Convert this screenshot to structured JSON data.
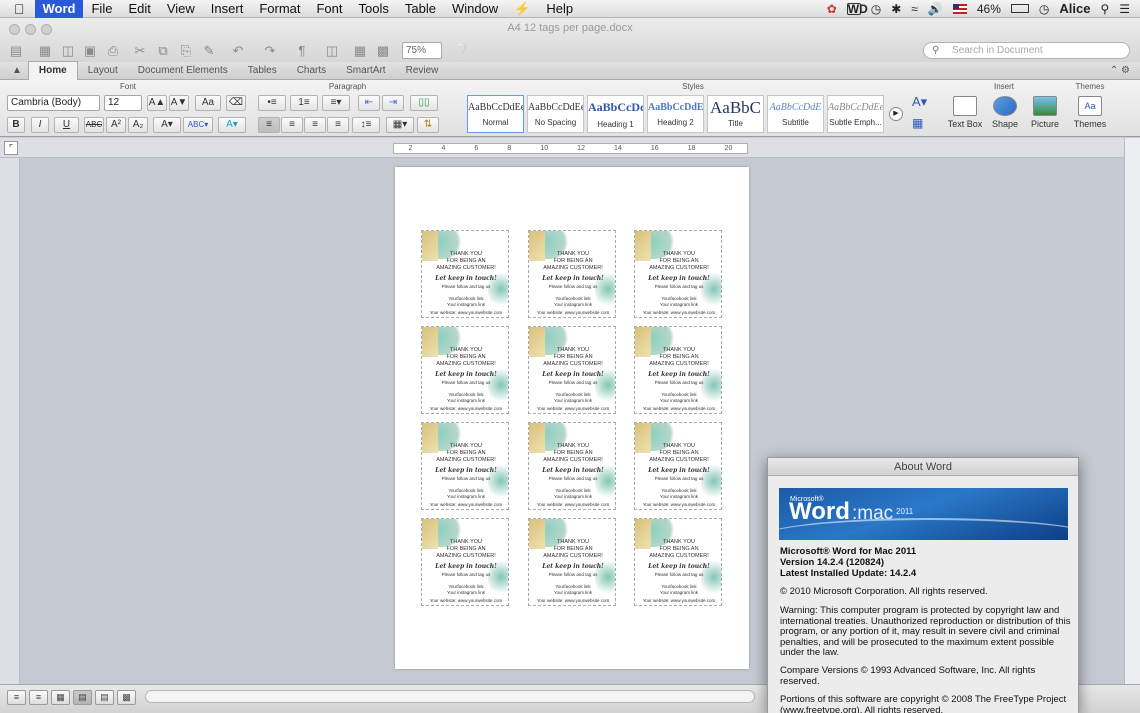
{
  "menubar": {
    "app": "Word",
    "items": [
      "File",
      "Edit",
      "View",
      "Insert",
      "Format",
      "Font",
      "Tools",
      "Table",
      "Window",
      "Help"
    ],
    "battery": "46%",
    "user": "Alice"
  },
  "window": {
    "title": "A4 12 tags per page.docx",
    "zoom": "75%",
    "search_placeholder": "Search in Document"
  },
  "ribbon_tabs": [
    "Home",
    "Layout",
    "Document Elements",
    "Tables",
    "Charts",
    "SmartArt",
    "Review"
  ],
  "ribbon": {
    "groups": {
      "font": "Font",
      "paragraph": "Paragraph",
      "styles": "Styles",
      "insert": "Insert",
      "themes": "Themes"
    },
    "font_name": "Cambria (Body)",
    "font_size": "12",
    "styles": [
      {
        "preview": "AaBbCcDdEe",
        "name": "Normal"
      },
      {
        "preview": "AaBbCcDdEe",
        "name": "No Spacing"
      },
      {
        "preview": "AaBbCcDd",
        "name": "Heading 1"
      },
      {
        "preview": "AaBbCcDdEe",
        "name": "Heading 2"
      },
      {
        "preview": "AaBbC",
        "name": "Title"
      },
      {
        "preview": "AaBbCcDdE",
        "name": "Subtitle"
      },
      {
        "preview": "AaBbCcDdEe",
        "name": "Subtle Emph..."
      }
    ],
    "insert": [
      "Text Box",
      "Shape",
      "Picture"
    ],
    "themes_label": "Themes"
  },
  "tag": {
    "line1": "THANK YOU",
    "line2": "FOR BEING AN",
    "line3": "AMAZING CUSTOMER!",
    "script": "Let keep in touch!",
    "follow": "Please follow and tag us",
    "fb": "Yourfacebook link",
    "ig": "Your instagram link",
    "web": "Your website: www.yourwebsite.com"
  },
  "about": {
    "title": "About Word",
    "banner_ms": "Microsoft®",
    "banner_word": "Word",
    "banner_mac": ":mac",
    "banner_year": "2011",
    "product": "Microsoft® Word for Mac 2011",
    "version": "Version 14.2.4 (120824)",
    "update": "Latest Installed Update: 14.2.4",
    "copyright": "© 2010 Microsoft Corporation. All rights reserved.",
    "warning": "Warning: This computer program is protected by copyright law and international treaties.  Unauthorized reproduction or distribution of this program, or any portion of it, may result in severe civil and criminal penalties, and will be prosecuted to the maximum extent possible under the law.",
    "compare": "Compare Versions © 1993 Advanced Software, Inc.  All rights reserved.",
    "freetype": "Portions of this software are copyright © 2008 The FreeType Project (www.freetype.org).  All rights reserved."
  }
}
